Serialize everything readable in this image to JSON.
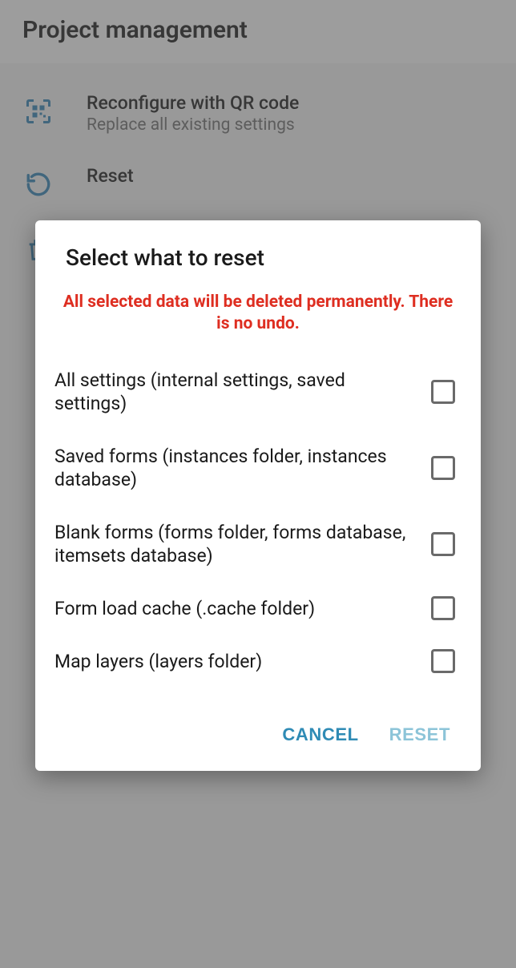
{
  "header": {
    "title": "Project management"
  },
  "settings": {
    "items": [
      {
        "icon": "qr-icon",
        "title": "Reconfigure with QR code",
        "sub": "Replace all existing settings"
      },
      {
        "icon": "reset-icon",
        "title": "Reset",
        "sub": ""
      },
      {
        "icon": "delete-icon",
        "title": "",
        "sub": ""
      }
    ]
  },
  "dialog": {
    "title": "Select what to reset",
    "warning": "All selected data will be deleted permanently. There is no undo.",
    "options": [
      {
        "label": "All settings (internal settings, saved settings)"
      },
      {
        "label": "Saved forms (instances folder, instances database)"
      },
      {
        "label": "Blank forms (forms folder, forms database, itemsets database)"
      },
      {
        "label": "Form load cache (.cache folder)"
      },
      {
        "label": "Map layers (layers folder)"
      }
    ],
    "cancel": "CANCEL",
    "reset": "RESET"
  }
}
